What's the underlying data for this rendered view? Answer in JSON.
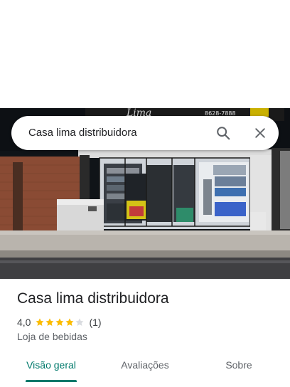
{
  "search": {
    "query": "Casa lima distribuidora",
    "search_icon": "search-icon",
    "close_icon": "close-icon"
  },
  "photo": {
    "signage_text": "Lima",
    "phone_text": "8628-7888",
    "description_icon": "storefront-photo"
  },
  "place": {
    "name": "Casa lima distribuidora",
    "rating_value": "4,0",
    "rating_stars": 4,
    "rating_max": 5,
    "review_count": "(1)",
    "category": "Loja de bebidas",
    "star_color": "#fbbc04",
    "star_empty_color": "#dadce0"
  },
  "tabs": [
    {
      "label": "Visão geral",
      "active": true
    },
    {
      "label": "Avaliações",
      "active": false
    },
    {
      "label": "Sobre",
      "active": false
    }
  ],
  "colors": {
    "accent": "#00796b"
  }
}
